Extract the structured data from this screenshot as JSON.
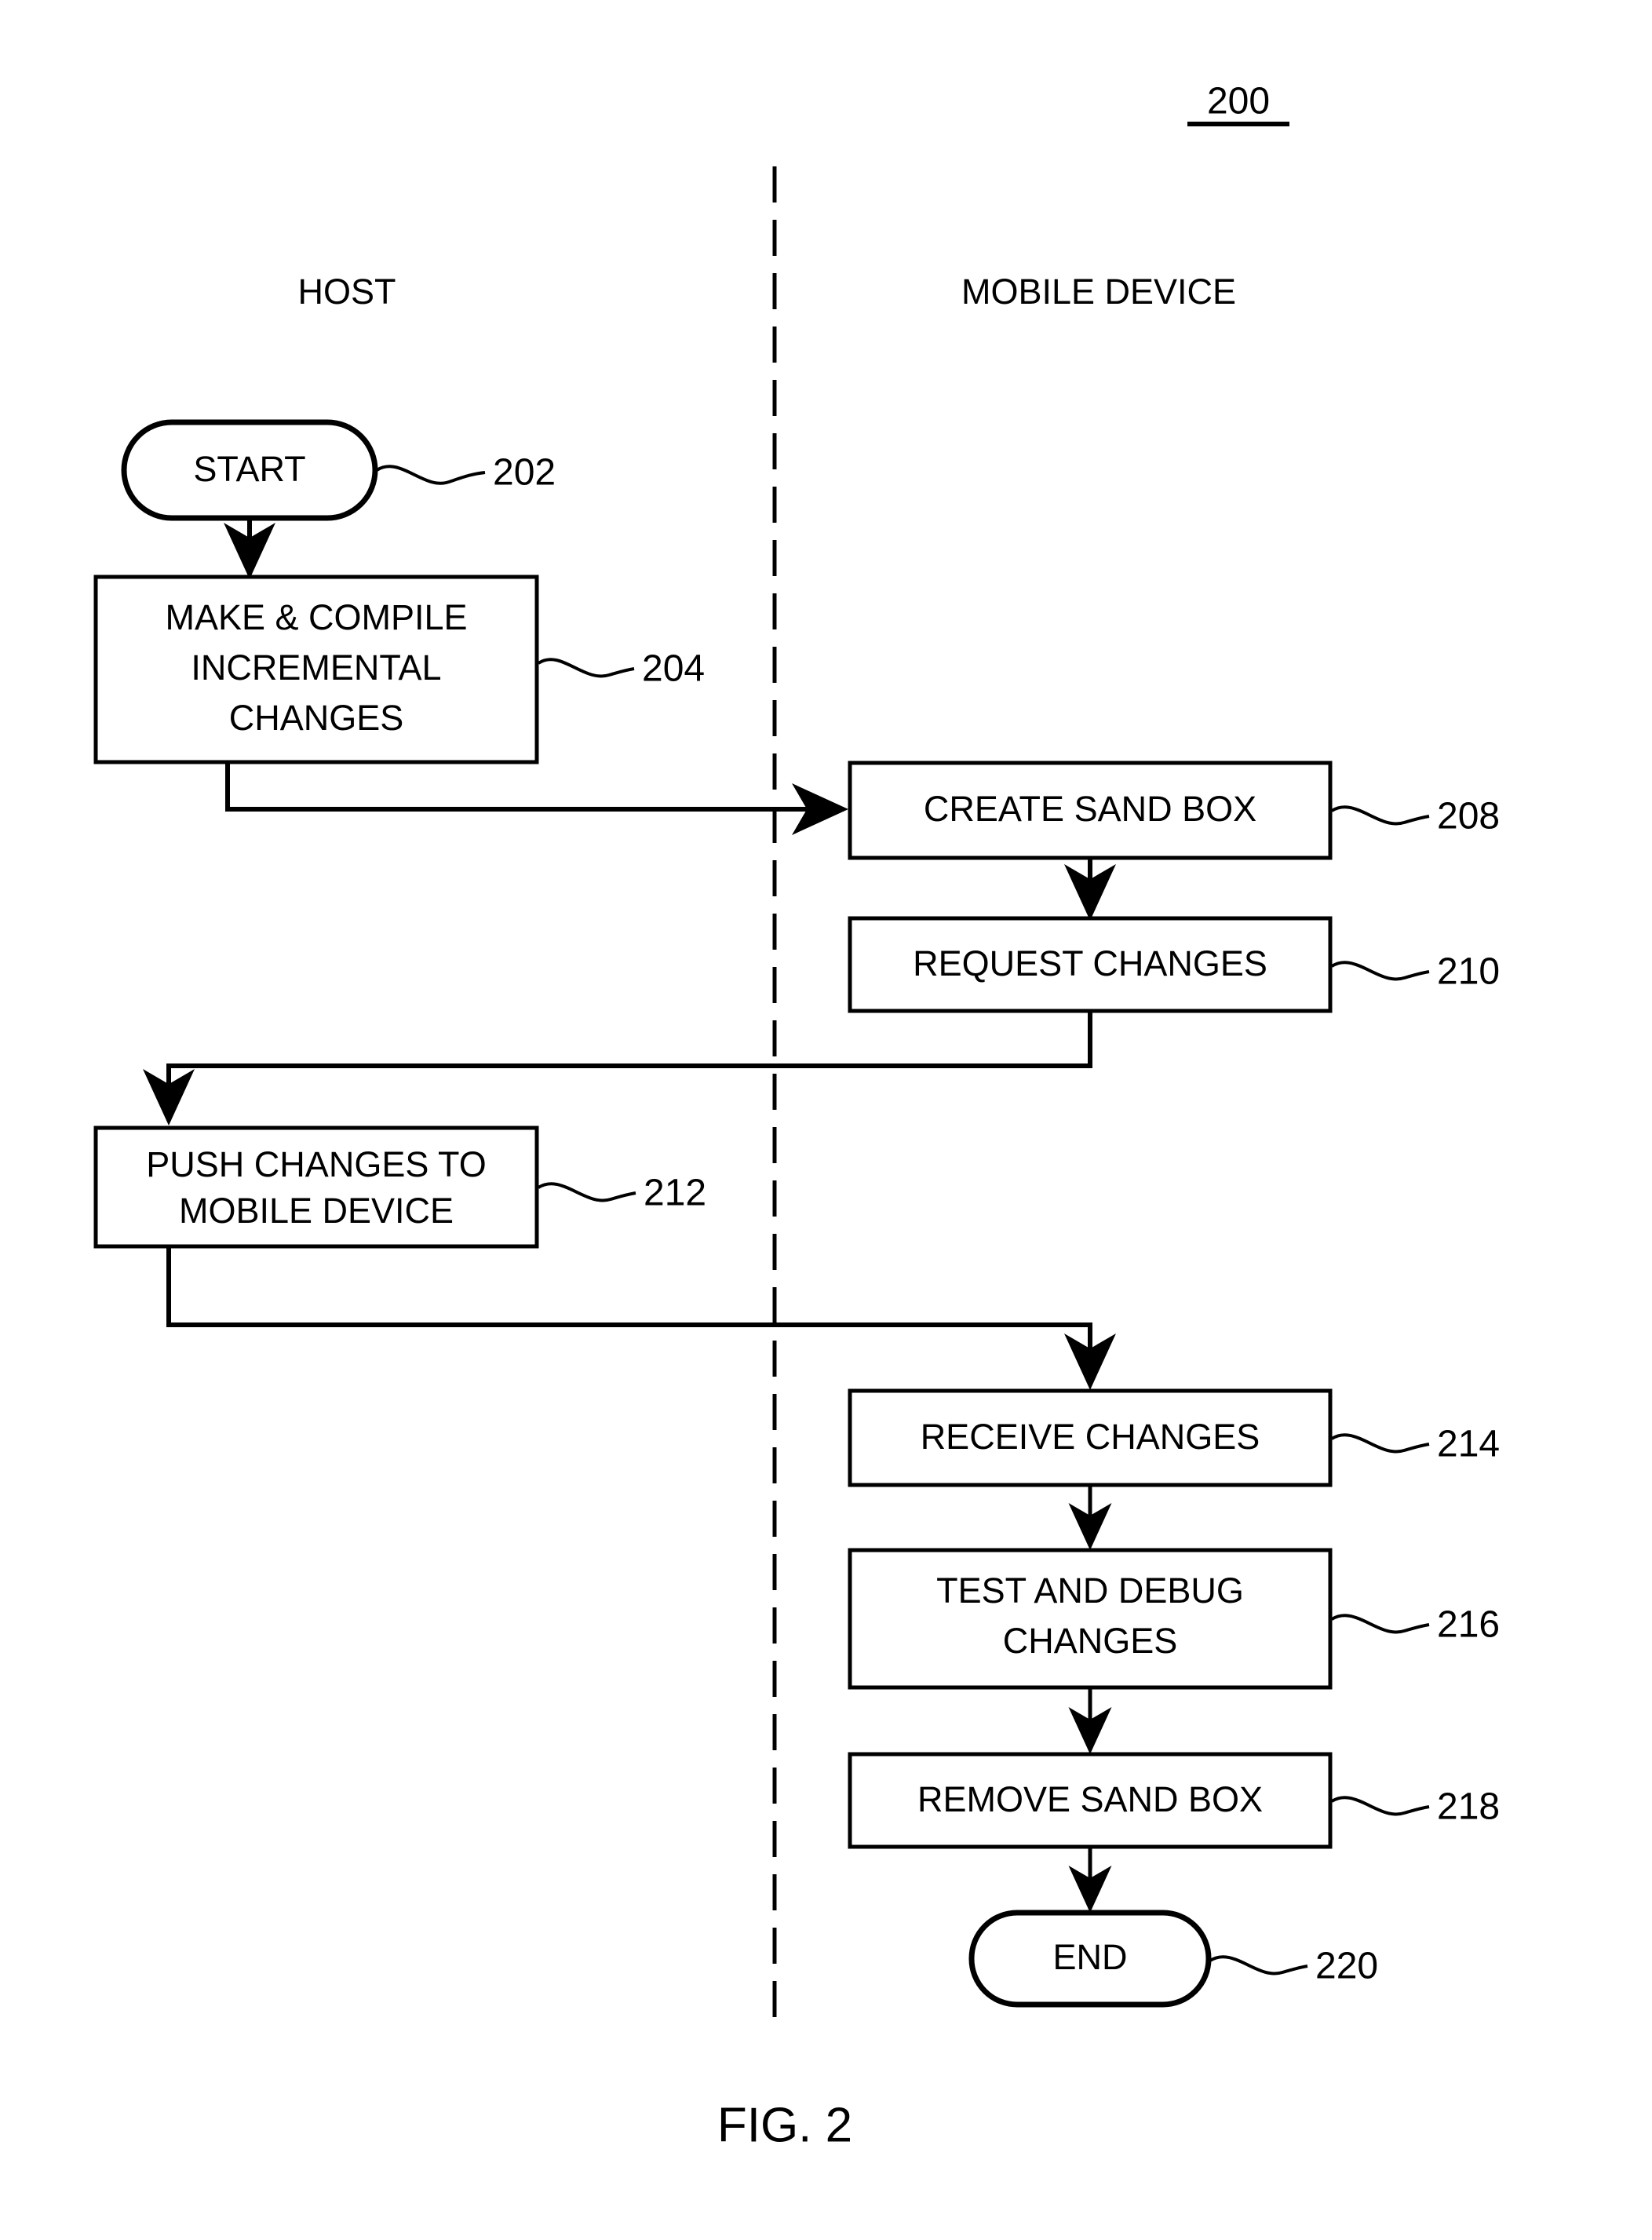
{
  "figure": {
    "number_label": "200",
    "caption": "FIG. 2"
  },
  "swimlanes": [
    {
      "id": "host",
      "title": "HOST"
    },
    {
      "id": "mobile",
      "title": "MOBILE DEVICE"
    }
  ],
  "chart_data": {
    "type": "diagram",
    "subtype": "swimlane-flowchart",
    "title": "200",
    "caption": "FIG. 2",
    "lanes": [
      "HOST",
      "MOBILE DEVICE"
    ],
    "nodes": [
      {
        "ref": "202",
        "lane": "HOST",
        "shape": "terminator",
        "lines": [
          "START"
        ]
      },
      {
        "ref": "204",
        "lane": "HOST",
        "shape": "process",
        "lines": [
          "MAKE & COMPILE",
          "INCREMENTAL",
          "CHANGES"
        ]
      },
      {
        "ref": "208",
        "lane": "MOBILE DEVICE",
        "shape": "process",
        "lines": [
          "CREATE SAND BOX"
        ]
      },
      {
        "ref": "210",
        "lane": "MOBILE DEVICE",
        "shape": "process",
        "lines": [
          "REQUEST CHANGES"
        ]
      },
      {
        "ref": "212",
        "lane": "HOST",
        "shape": "process",
        "lines": [
          "PUSH CHANGES TO",
          "MOBILE DEVICE"
        ]
      },
      {
        "ref": "214",
        "lane": "MOBILE DEVICE",
        "shape": "process",
        "lines": [
          "RECEIVE CHANGES"
        ]
      },
      {
        "ref": "216",
        "lane": "MOBILE DEVICE",
        "shape": "process",
        "lines": [
          "TEST AND DEBUG",
          "CHANGES"
        ]
      },
      {
        "ref": "218",
        "lane": "MOBILE DEVICE",
        "shape": "process",
        "lines": [
          "REMOVE SAND BOX"
        ]
      },
      {
        "ref": "220",
        "lane": "MOBILE DEVICE",
        "shape": "terminator",
        "lines": [
          "END"
        ]
      }
    ],
    "edges": [
      {
        "from": "202",
        "to": "204",
        "style": "straight-down"
      },
      {
        "from": "204",
        "to": "208",
        "style": "cross-lane-right"
      },
      {
        "from": "208",
        "to": "210",
        "style": "straight-down"
      },
      {
        "from": "210",
        "to": "212",
        "style": "cross-lane-left"
      },
      {
        "from": "212",
        "to": "214",
        "style": "cross-lane-right"
      },
      {
        "from": "214",
        "to": "216",
        "style": "straight-down"
      },
      {
        "from": "216",
        "to": "218",
        "style": "straight-down"
      },
      {
        "from": "218",
        "to": "220",
        "style": "straight-down"
      }
    ]
  },
  "nodes": {
    "start": {
      "ref": "202",
      "label": "START"
    },
    "make_compile": {
      "ref": "204",
      "line1": "MAKE & COMPILE",
      "line2": "INCREMENTAL",
      "line3": "CHANGES"
    },
    "create_sandbox": {
      "ref": "208",
      "label": "CREATE SAND BOX"
    },
    "request_changes": {
      "ref": "210",
      "label": "REQUEST CHANGES"
    },
    "push_changes": {
      "ref": "212",
      "line1": "PUSH CHANGES TO",
      "line2": "MOBILE DEVICE"
    },
    "receive_changes": {
      "ref": "214",
      "label": "RECEIVE CHANGES"
    },
    "test_debug": {
      "ref": "216",
      "line1": "TEST AND DEBUG",
      "line2": "CHANGES"
    },
    "remove_sandbox": {
      "ref": "218",
      "label": "REMOVE SAND BOX"
    },
    "end": {
      "ref": "220",
      "label": "END"
    }
  },
  "colors": {
    "ink": "#000000",
    "paper": "#ffffff"
  }
}
